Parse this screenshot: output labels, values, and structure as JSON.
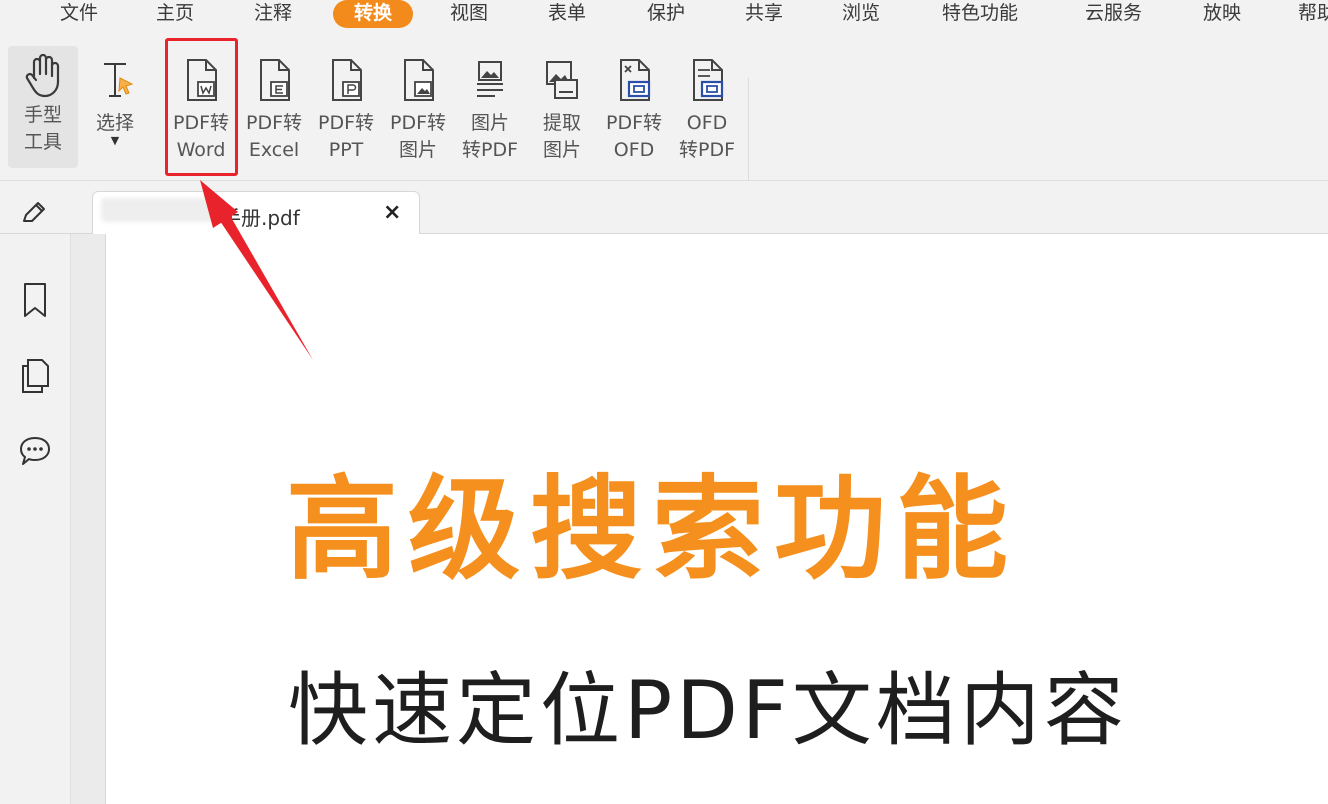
{
  "menu": {
    "items": [
      "文件",
      "主页",
      "注释",
      "转换",
      "视图",
      "表单",
      "保护",
      "共享",
      "浏览",
      "特色功能",
      "云服务",
      "放映",
      "帮助"
    ],
    "active": "转换"
  },
  "ribbon": {
    "hand_tool": "手型\n工具",
    "select_tool": "选择",
    "tools": [
      {
        "name": "pdf-to-word",
        "label": "PDF转\nWord",
        "icon": "word-doc-icon"
      },
      {
        "name": "pdf-to-excel",
        "label": "PDF转\nExcel",
        "icon": "excel-doc-icon"
      },
      {
        "name": "pdf-to-ppt",
        "label": "PDF转\nPPT",
        "icon": "ppt-doc-icon"
      },
      {
        "name": "pdf-to-image",
        "label": "PDF转\n图片",
        "icon": "image-doc-icon"
      },
      {
        "name": "image-to-pdf",
        "label": "图片\n转PDF",
        "icon": "image-to-pdf-icon"
      },
      {
        "name": "extract-image",
        "label": "提取\n图片",
        "icon": "extract-image-icon"
      },
      {
        "name": "pdf-to-ofd",
        "label": "PDF转\nOFD",
        "icon": "ofd-doc-icon"
      },
      {
        "name": "ofd-to-pdf",
        "label": "OFD\n转PDF",
        "icon": "ofd-to-pdf-icon"
      }
    ]
  },
  "tab": {
    "title": "手册.pdf",
    "close": "×"
  },
  "document": {
    "title": "高级搜索功能",
    "subtitle": "快速定位PDF文档内容"
  },
  "colors": {
    "accent": "#f28a1c",
    "highlight": "#e8232b",
    "doc_title": "#f5901e"
  }
}
